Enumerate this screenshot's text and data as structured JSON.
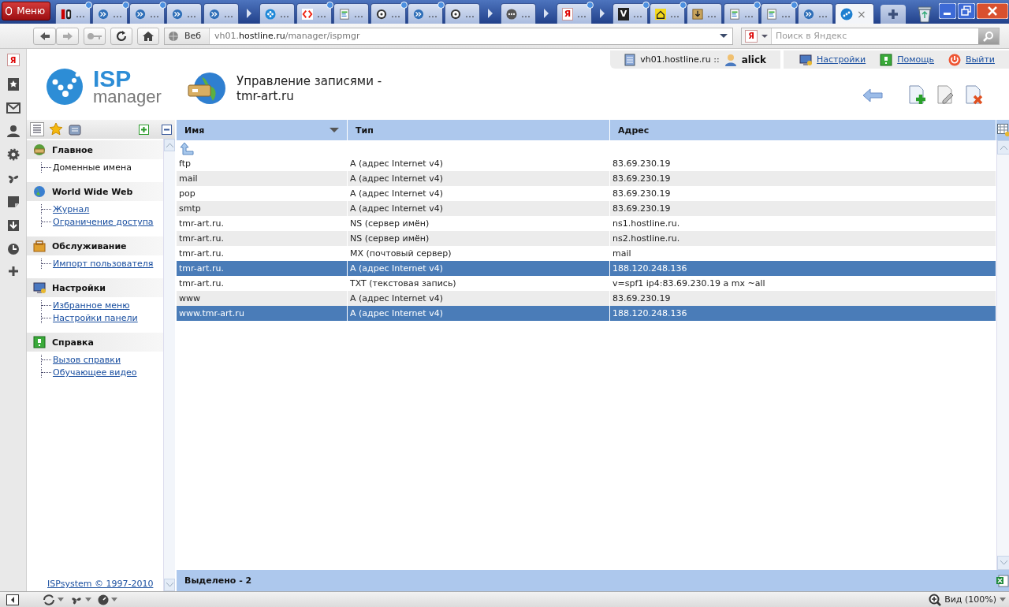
{
  "browser": {
    "menu_label": "Меню",
    "tab_groups": [
      {
        "tabs": [
          {
            "kind": "fd",
            "label": "…",
            "updated": true,
            "selected": false
          },
          {
            "kind": "chevron",
            "label": "…",
            "updated": true,
            "selected": false
          },
          {
            "kind": "chevron",
            "label": "…",
            "updated": true,
            "selected": false
          },
          {
            "kind": "chevron",
            "label": "…",
            "updated": false,
            "selected": false
          },
          {
            "kind": "chevron",
            "label": "…",
            "updated": false,
            "selected": false
          }
        ]
      },
      {
        "tabs": [
          {
            "kind": "flower",
            "label": "…",
            "updated": false,
            "selected": false
          },
          {
            "kind": "code",
            "label": "…",
            "updated": true,
            "selected": false
          },
          {
            "kind": "document",
            "label": "…",
            "updated": false,
            "selected": false
          },
          {
            "kind": "disc",
            "label": "…",
            "updated": true,
            "selected": false
          },
          {
            "kind": "chevron",
            "label": "…",
            "updated": true,
            "selected": false
          },
          {
            "kind": "disc",
            "label": "…",
            "updated": false,
            "selected": false
          }
        ]
      },
      {
        "tabs": [
          {
            "kind": "dots",
            "label": "…",
            "updated": false,
            "selected": false
          }
        ]
      },
      {
        "tabs": [
          {
            "kind": "letter",
            "icon_text": "Я",
            "label": "…",
            "updated": true,
            "selected": false
          }
        ]
      },
      {
        "tabs": [
          {
            "kind": "letter-dark",
            "icon_text": "V",
            "label": "…",
            "updated": true,
            "selected": false
          },
          {
            "kind": "house",
            "label": "…",
            "updated": true,
            "selected": false
          },
          {
            "kind": "download",
            "label": "…",
            "updated": false,
            "selected": false
          },
          {
            "kind": "document",
            "label": "…",
            "updated": true,
            "selected": false
          },
          {
            "kind": "document",
            "label": "…",
            "updated": true,
            "selected": false
          },
          {
            "kind": "chevron",
            "label": "…",
            "updated": false,
            "selected": false
          },
          {
            "kind": "network",
            "close": "×",
            "updated": false,
            "selected": true
          }
        ]
      }
    ],
    "scheme_label": "Веб",
    "url_prefix": "vh01.",
    "url_domain": "hostline.ru",
    "url_path": "/manager/ispmgr",
    "search": {
      "engine": "Я",
      "placeholder": "Поиск в Яндекс"
    },
    "panel_items": [
      {
        "kind": "letter",
        "text": "Я"
      },
      {
        "kind": "bookmarks"
      },
      {
        "kind": "mail"
      },
      {
        "kind": "contacts"
      },
      {
        "kind": "settings"
      },
      {
        "kind": "fan"
      },
      {
        "kind": "notes"
      },
      {
        "kind": "downloads"
      },
      {
        "kind": "history"
      },
      {
        "kind": "add"
      }
    ],
    "zoom_label": "Вид (100%)"
  },
  "page": {
    "logo": {
      "line1": "ISP",
      "line2": "manager"
    },
    "title": [
      "Управление записями -",
      "tmr-art.ru"
    ],
    "user_bar": {
      "host": "vh01.hostline.ru ::",
      "user": "alick"
    },
    "links": [
      {
        "kind": "settings",
        "label": "Настройки"
      },
      {
        "kind": "help",
        "label": "Помощь"
      },
      {
        "kind": "logout",
        "label": "Выйти"
      }
    ],
    "nav": [
      {
        "kind": "main",
        "title": "Главное",
        "items": [
          {
            "label": "Доменные имена",
            "selected": true
          }
        ]
      },
      {
        "kind": "web",
        "title": "World Wide Web",
        "items": [
          {
            "label": "Журнал",
            "selected": false
          },
          {
            "label": "Ограничение доступа",
            "selected": false
          }
        ]
      },
      {
        "kind": "service",
        "title": "Обслуживание",
        "items": [
          {
            "label": "Импорт пользователя",
            "selected": false
          }
        ]
      },
      {
        "kind": "settings",
        "title": "Настройки",
        "items": [
          {
            "label": "Избранное меню",
            "selected": false
          },
          {
            "label": "Настройки панели",
            "selected": false
          }
        ]
      },
      {
        "kind": "help",
        "title": "Справка",
        "items": [
          {
            "label": "Вызов справки",
            "selected": false
          },
          {
            "label": "Обучающее видео",
            "selected": false
          }
        ]
      }
    ],
    "copyright": "ISPsystem © 1997-2010",
    "table": {
      "columns": [
        {
          "label": "Имя",
          "sorted": true
        },
        {
          "label": "Тип",
          "sorted": false
        },
        {
          "label": "Адрес",
          "sorted": false
        }
      ],
      "rows": [
        {
          "name": "ftp",
          "type": "A (адрес Internet v4)",
          "address": "83.69.230.19",
          "selected": false
        },
        {
          "name": "mail",
          "type": "A (адрес Internet v4)",
          "address": "83.69.230.19",
          "selected": false
        },
        {
          "name": "pop",
          "type": "A (адрес Internet v4)",
          "address": "83.69.230.19",
          "selected": false
        },
        {
          "name": "smtp",
          "type": "A (адрес Internet v4)",
          "address": "83.69.230.19",
          "selected": false
        },
        {
          "name": "tmr-art.ru.",
          "type": "NS (сервер имён)",
          "address": "ns1.hostline.ru.",
          "selected": false
        },
        {
          "name": "tmr-art.ru.",
          "type": "NS (сервер имён)",
          "address": "ns2.hostline.ru.",
          "selected": false
        },
        {
          "name": "tmr-art.ru.",
          "type": "MX (почтовый сервер)",
          "address": "mail",
          "selected": false
        },
        {
          "name": "tmr-art.ru.",
          "type": "A (адрес Internet v4)",
          "address": "188.120.248.136",
          "selected": true
        },
        {
          "name": "tmr-art.ru.",
          "type": "TXT (текстовая запись)",
          "address": "v=spf1 ip4:83.69.230.19 a mx ~all",
          "selected": false
        },
        {
          "name": "www",
          "type": "A (адрес Internet v4)",
          "address": "83.69.230.19",
          "selected": false
        },
        {
          "name": "www.tmr-art.ru",
          "type": "A (адрес Internet v4)",
          "address": "188.120.248.136",
          "selected": true
        }
      ],
      "footer": "Выделено - 2"
    }
  }
}
